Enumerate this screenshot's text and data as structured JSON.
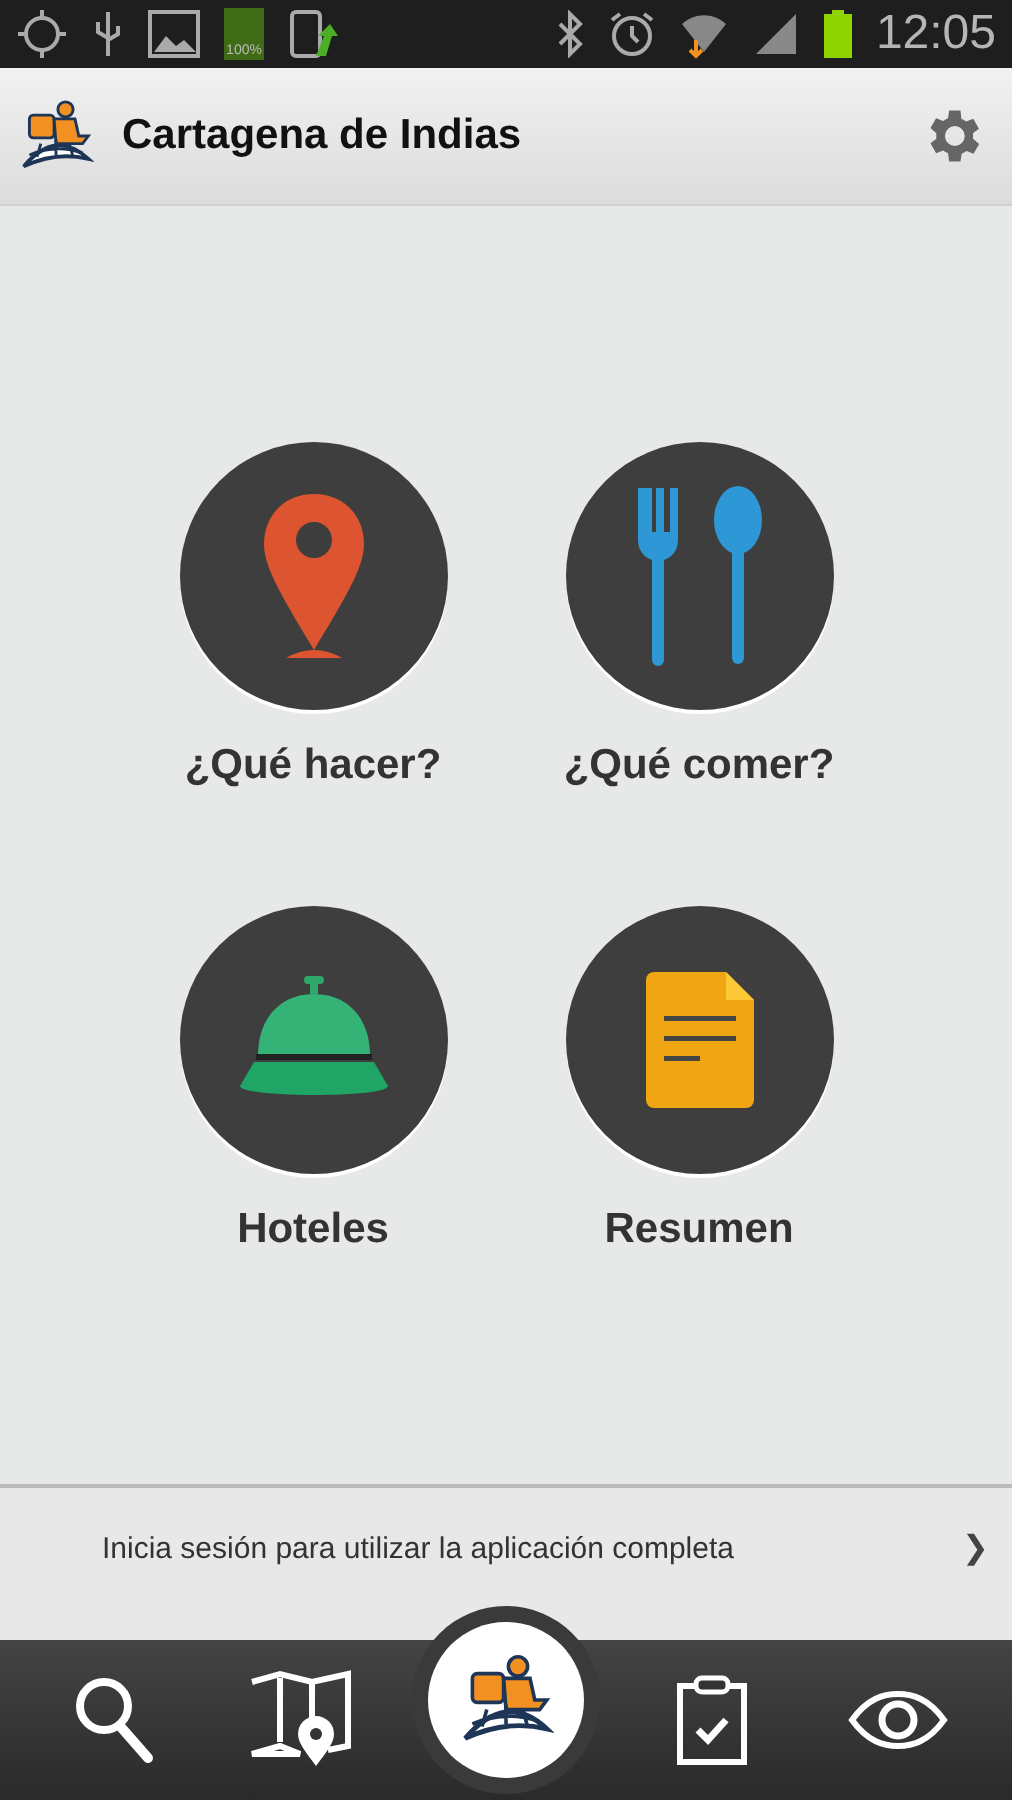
{
  "status_bar": {
    "battery_label": "100%",
    "time": "12:05"
  },
  "header": {
    "title": "Cartagena de Indias"
  },
  "tiles": [
    {
      "kind": "pin",
      "label": "¿Qué hacer?"
    },
    {
      "kind": "cutlery",
      "label": "¿Qué comer?"
    },
    {
      "kind": "bell",
      "label": "Hoteles"
    },
    {
      "kind": "document",
      "label": "Resumen"
    }
  ],
  "banner": {
    "text": "Inicia sesión para utilizar la aplicación completa",
    "arrow": "❯"
  },
  "nav": [
    {
      "kind": "search",
      "selected": false
    },
    {
      "kind": "map",
      "selected": false
    },
    {
      "kind": "logo",
      "selected": true
    },
    {
      "kind": "clipboard",
      "selected": false
    },
    {
      "kind": "eye",
      "selected": false
    }
  ]
}
